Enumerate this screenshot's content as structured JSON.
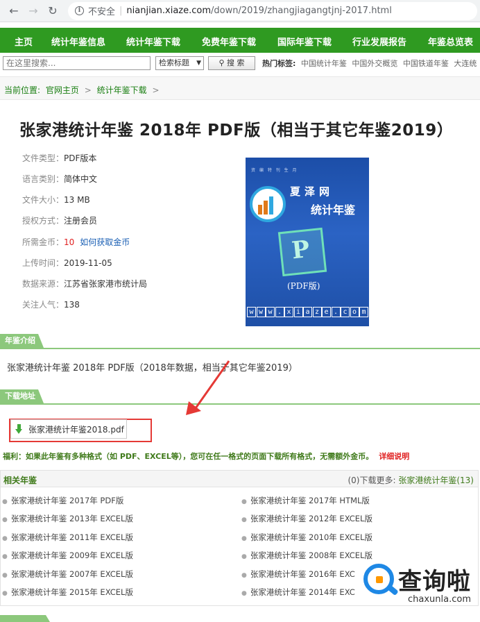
{
  "browser": {
    "insecure_label": "不安全",
    "url_host": "nianjian.xiaze.com",
    "url_path": "/down/2019/zhangjiagangtjnj-2017.html"
  },
  "nav": {
    "items": [
      "主页",
      "统计年鉴信息",
      "统计年鉴下载",
      "免费年鉴下载",
      "国际年鉴下载",
      "行业发展报告",
      "年鉴总览表"
    ]
  },
  "search": {
    "placeholder": "在这里搜索...",
    "select_value": "检索标题",
    "button": "搜 索",
    "hot_label": "热门标签:",
    "hot_tags": [
      "中国统计年鉴",
      "中国外交概览",
      "中国铁道年鉴",
      "大连统"
    ]
  },
  "breadcrumb": {
    "prefix": "当前位置:",
    "items": [
      "官网主页",
      "统计年鉴下载"
    ]
  },
  "page": {
    "title": "张家港统计年鉴 2018年 PDF版（相当于其它年鉴2019）"
  },
  "meta": {
    "file_type_k": "文件类型：",
    "file_type_v": "PDF版本",
    "lang_k": "语言类别：",
    "lang_v": "简体中文",
    "size_k": "文件大小：",
    "size_v": "13 MB",
    "auth_k": "授权方式：",
    "auth_v": "注册会员",
    "coins_k": "所需金币：",
    "coins_v": "10",
    "coins_link": "如何获取金币",
    "upload_k": "上传时间：",
    "upload_v": "2019-11-05",
    "source_k": "数据来源：",
    "source_v": "江苏省张家港市统计局",
    "pop_k": "关注人气：",
    "pop_v": "138"
  },
  "cover": {
    "topline": "资 编 特 刊 生 月",
    "brand": "夏泽网",
    "subtitle": "统计年鉴",
    "pdf_letter": "P",
    "pdf_text": "(PDF版)",
    "www_chars": [
      "w",
      "w",
      "w",
      ".",
      "x",
      "i",
      "a",
      "z",
      "e",
      ".",
      "c",
      "o",
      "m"
    ]
  },
  "sections": {
    "intro_tab": "年鉴介绍",
    "intro_text": "张家港统计年鉴 2018年 PDF版（2018年数据，相当于其它年鉴2019）",
    "download_tab": "下载地址",
    "download_file": "张家港统计年鉴2018.pdf",
    "benefit_text": "福利：如果此年鉴有多种格式（如 PDF、EXCEL等），您可在任一格式的页面下载所有格式，无需额外金币。",
    "benefit_detail": "详细说明"
  },
  "related": {
    "title": "相关年鉴",
    "more_prefix": "(0)下载更多:",
    "more_link": "张家港统计年鉴(13)",
    "left": [
      "张家港统计年鉴 2017年 PDF版",
      "张家港统计年鉴 2013年 EXCEL版",
      "张家港统计年鉴 2011年 EXCEL版",
      "张家港统计年鉴 2009年 EXCEL版",
      "张家港统计年鉴 2007年 EXCEL版",
      "张家港统计年鉴 2015年 EXCEL版"
    ],
    "right": [
      "张家港统计年鉴 2017年 HTML版",
      "张家港统计年鉴 2012年 EXCEL版",
      "张家港统计年鉴 2010年 EXCEL版",
      "张家港统计年鉴 2008年 EXCEL版",
      "张家港统计年鉴 2016年 EXC",
      "张家港统计年鉴 2014年 EXC"
    ]
  },
  "watermark": {
    "cn": "查询啦",
    "domain": "chaxunla.com"
  }
}
